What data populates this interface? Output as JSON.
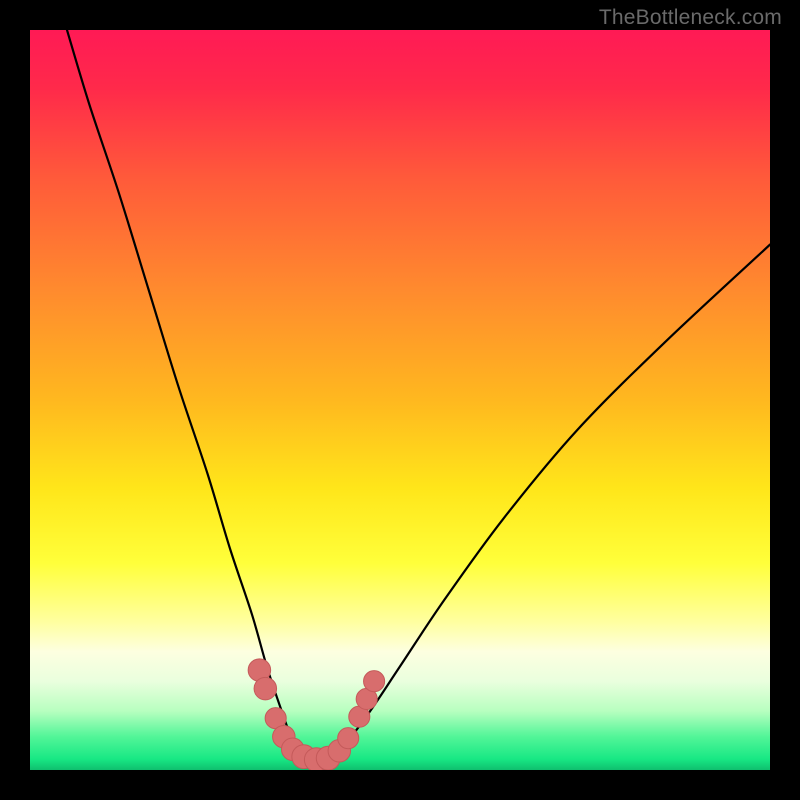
{
  "watermark": "TheBottleneck.com",
  "colors": {
    "black": "#000000",
    "watermark_text": "#6a6a6a",
    "curve_stroke": "#000000",
    "bead_fill": "#d86d6d",
    "bead_stroke": "#c45a5a",
    "gradient_stops": [
      {
        "offset": 0.0,
        "color": "#ff1a55"
      },
      {
        "offset": 0.08,
        "color": "#ff2a4a"
      },
      {
        "offset": 0.2,
        "color": "#ff5a3a"
      },
      {
        "offset": 0.35,
        "color": "#ff8a2e"
      },
      {
        "offset": 0.5,
        "color": "#ffb81f"
      },
      {
        "offset": 0.62,
        "color": "#ffe61a"
      },
      {
        "offset": 0.72,
        "color": "#ffff3a"
      },
      {
        "offset": 0.8,
        "color": "#ffffa0"
      },
      {
        "offset": 0.84,
        "color": "#fdffe0"
      },
      {
        "offset": 0.88,
        "color": "#eaffde"
      },
      {
        "offset": 0.92,
        "color": "#b8ffc0"
      },
      {
        "offset": 0.955,
        "color": "#52f598"
      },
      {
        "offset": 0.985,
        "color": "#18e884"
      },
      {
        "offset": 1.0,
        "color": "#0fbf6e"
      }
    ]
  },
  "chart_data": {
    "type": "line",
    "title": "",
    "xlabel": "",
    "ylabel": "",
    "xlim": [
      0,
      100
    ],
    "ylim": [
      0,
      100
    ],
    "grid": false,
    "description": "Gradient background from red (top) through orange/yellow to green (bottom) with a black V-shaped curve whose vertex sits near the bottom. A cluster of salmon-pink beads lines the trough of the V.",
    "series": [
      {
        "name": "left-branch",
        "x": [
          5,
          8,
          12,
          16,
          20,
          24,
          27,
          30,
          32,
          34,
          35.5,
          37
        ],
        "y": [
          100,
          90,
          78,
          65,
          52,
          40,
          30,
          21,
          14,
          8,
          4,
          2
        ]
      },
      {
        "name": "right-branch",
        "x": [
          41,
          43,
          46,
          50,
          56,
          64,
          74,
          86,
          100
        ],
        "y": [
          2,
          4,
          8,
          14,
          23,
          34,
          46,
          58,
          71
        ]
      },
      {
        "name": "trough",
        "x": [
          37,
          38.5,
          40,
          41
        ],
        "y": [
          2,
          1.3,
          1.3,
          2
        ]
      }
    ],
    "beads": [
      {
        "x": 31.0,
        "y": 13.5,
        "r": 1.6
      },
      {
        "x": 31.8,
        "y": 11.0,
        "r": 1.6
      },
      {
        "x": 33.2,
        "y": 7.0,
        "r": 1.5
      },
      {
        "x": 34.3,
        "y": 4.5,
        "r": 1.6
      },
      {
        "x": 35.5,
        "y": 2.8,
        "r": 1.6
      },
      {
        "x": 37.0,
        "y": 1.8,
        "r": 1.7
      },
      {
        "x": 38.7,
        "y": 1.4,
        "r": 1.7
      },
      {
        "x": 40.3,
        "y": 1.6,
        "r": 1.7
      },
      {
        "x": 41.8,
        "y": 2.6,
        "r": 1.6
      },
      {
        "x": 43.0,
        "y": 4.3,
        "r": 1.5
      },
      {
        "x": 44.5,
        "y": 7.2,
        "r": 1.5
      },
      {
        "x": 45.5,
        "y": 9.6,
        "r": 1.5
      },
      {
        "x": 46.5,
        "y": 12.0,
        "r": 1.5
      }
    ]
  }
}
